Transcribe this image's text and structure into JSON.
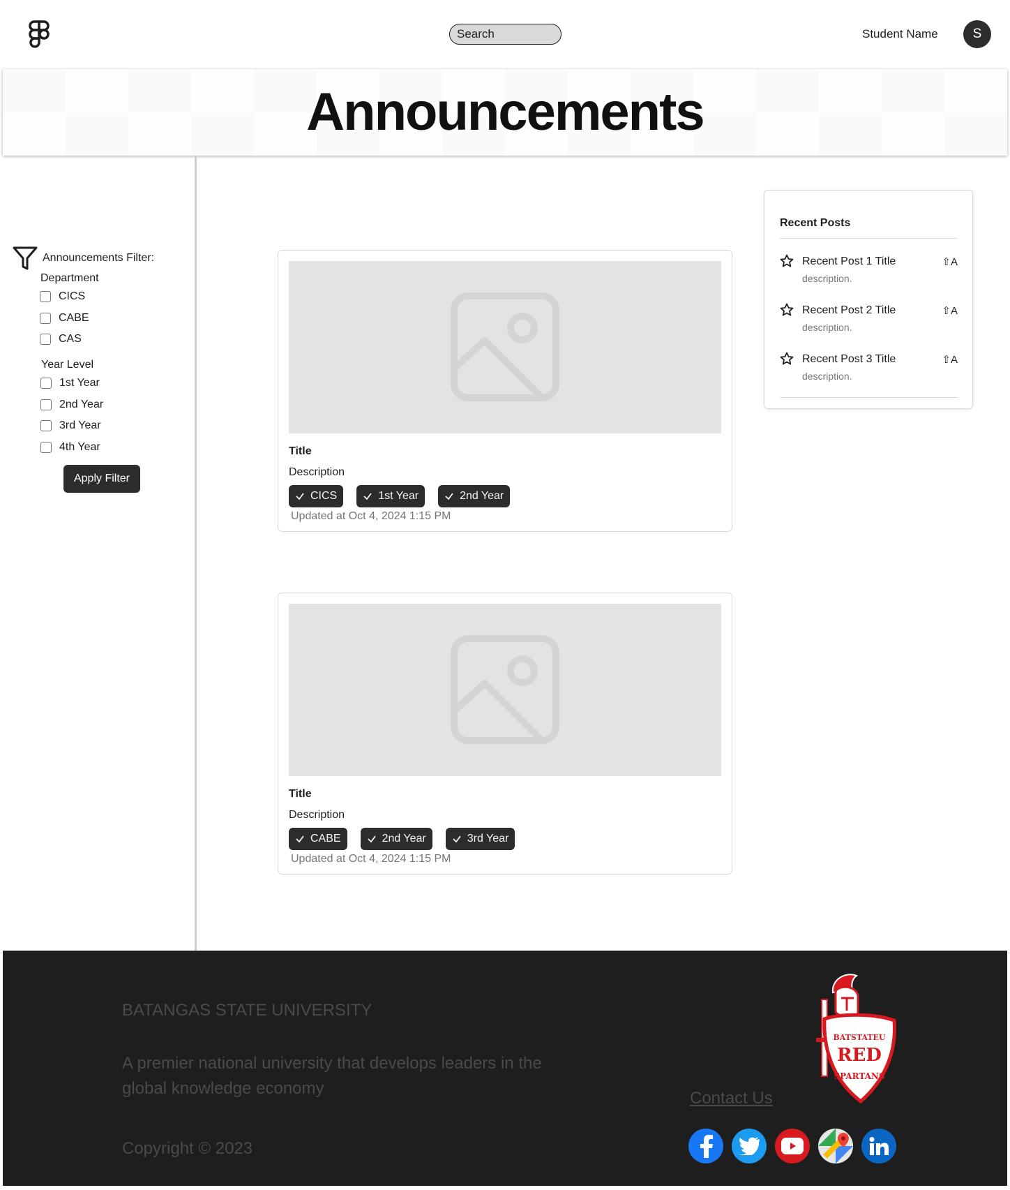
{
  "header": {
    "search_placeholder": "Search",
    "student_name": "Student Name",
    "avatar_initial": "S"
  },
  "page": {
    "title": "Announcements"
  },
  "filter": {
    "title": "Announcements Filter:",
    "department_label": "Department",
    "departments": [
      "CICS",
      "CABE",
      "CAS"
    ],
    "year_label": "Year Level",
    "years": [
      "1st Year",
      "2nd Year",
      "3rd Year",
      "4th Year"
    ],
    "apply_label": "Apply Filter"
  },
  "cards": [
    {
      "title": "Title",
      "description": "Description",
      "tags": [
        "CICS",
        "1st Year",
        "2nd Year"
      ],
      "updated": "Updated at Oct 4, 2024 1:15 PM"
    },
    {
      "title": "Title",
      "description": "Description",
      "tags": [
        "CABE",
        "2nd Year",
        "3rd Year"
      ],
      "updated": "Updated at Oct 4, 2024 1:15 PM"
    }
  ],
  "recent": {
    "title": "Recent Posts",
    "posts": [
      {
        "title": "Recent Post 1 Title",
        "description": "description.",
        "shortcut": "⇧A"
      },
      {
        "title": "Recent Post 2 Title",
        "description": "description.",
        "shortcut": "⇧A"
      },
      {
        "title": "Recent Post 3 Title",
        "description": "description.",
        "shortcut": "⇧A"
      }
    ]
  },
  "footer": {
    "university": "BATANGAS STATE UNIVERSITY",
    "tagline": "A premier national university that develops leaders in the global knowledge economy",
    "copyright": "Copyright © 2023",
    "contact": "Contact Us",
    "emblem_text_top": "BATSTATEU",
    "emblem_text_mid": "RED",
    "emblem_text_bottom": "SPARTANS",
    "socials": [
      "facebook-icon",
      "twitter-icon",
      "youtube-icon",
      "google-maps-icon",
      "linkedin-icon"
    ]
  },
  "colors": {
    "dark": "#2c2c2c",
    "footer_bg": "#1e1e1e",
    "placeholder_gray": "#e3e3e3",
    "brand_red": "#d71920"
  }
}
